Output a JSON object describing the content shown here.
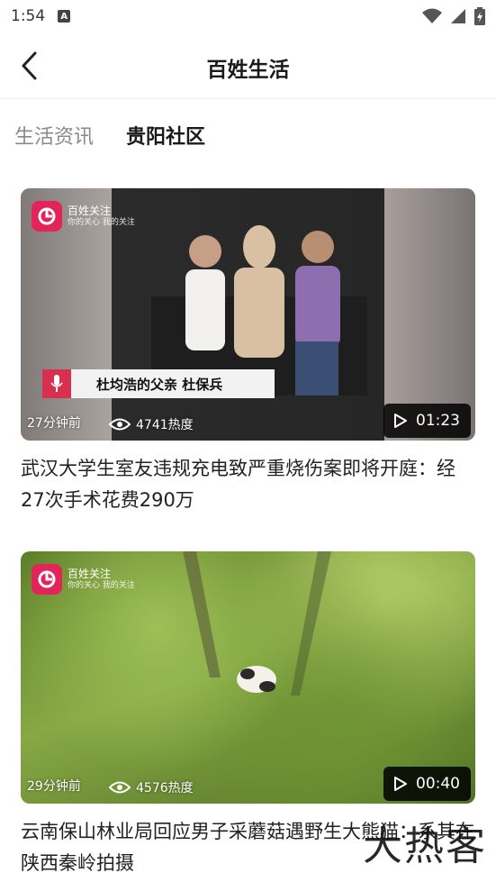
{
  "status_bar": {
    "time": "1:54",
    "a_icon": "A"
  },
  "header": {
    "title": "百姓生活"
  },
  "tabs": [
    {
      "label": "生活资讯",
      "active": false
    },
    {
      "label": "贵阳社区",
      "active": true
    }
  ],
  "brand": {
    "name": "百姓关注",
    "slogan": "你的关心 我的关注",
    "color": "#e3245a"
  },
  "articles": [
    {
      "time_ago": "27分钟前",
      "views": "4741热度",
      "duration": "01:23",
      "video_caption": "杜均浩的父亲 杜保兵",
      "title": "武汉大学生室友违规充电致严重烧伤案即将开庭：经27次手术花费290万"
    },
    {
      "time_ago": "29分钟前",
      "views": "4576热度",
      "duration": "00:40",
      "title": "云南保山林业局回应男子采蘑菇遇野生大熊猫：系其在陕西秦岭拍摄"
    }
  ],
  "watermark": "大热客",
  "colors": {
    "tab_underline": "#d6e6ff",
    "duration_bg": "#000000"
  }
}
